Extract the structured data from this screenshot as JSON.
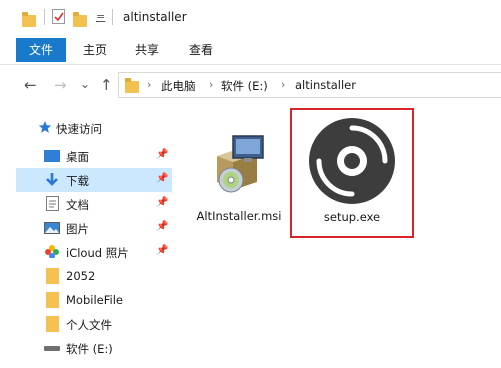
{
  "window": {
    "title": "altinstaller",
    "qat_dropdown_icon": "="
  },
  "ribbon": {
    "tabs": [
      "文件",
      "主页",
      "共享",
      "查看"
    ]
  },
  "address": {
    "back_glyph": "←",
    "forward_glyph": "→",
    "recent_glyph": "⌄",
    "up_glyph": "↑",
    "crumbs": [
      "此电脑",
      "软件 (E:)",
      "altinstaller"
    ],
    "crumb_separator": "›"
  },
  "nav": {
    "quick_access": "快速访问",
    "items": [
      {
        "label": "桌面",
        "icon": "desktop-icon",
        "pinned": true
      },
      {
        "label": "下载",
        "icon": "download-icon",
        "pinned": true,
        "selected": true
      },
      {
        "label": "文档",
        "icon": "document-icon",
        "pinned": true
      },
      {
        "label": "图片",
        "icon": "picture-icon",
        "pinned": true
      },
      {
        "label": "iCloud 照片",
        "icon": "icloud-photos-icon",
        "pinned": true
      },
      {
        "label": "2052",
        "icon": "folder-icon",
        "pinned": false
      },
      {
        "label": "MobileFile",
        "icon": "folder-icon",
        "pinned": false
      },
      {
        "label": "个人文件",
        "icon": "folder-icon",
        "pinned": false
      },
      {
        "label": "软件 (E:)",
        "icon": "drive-icon",
        "pinned": false
      }
    ]
  },
  "files": [
    {
      "name": "AltInstaller.msi",
      "icon": "msi-installer-icon"
    },
    {
      "name": "setup.exe",
      "icon": "disc-setup-icon",
      "highlighted": true
    }
  ],
  "colors": {
    "accent": "#1979ca",
    "selection": "#cce8ff",
    "highlight_border": "#d8252a",
    "folder": "#f2c14f"
  }
}
